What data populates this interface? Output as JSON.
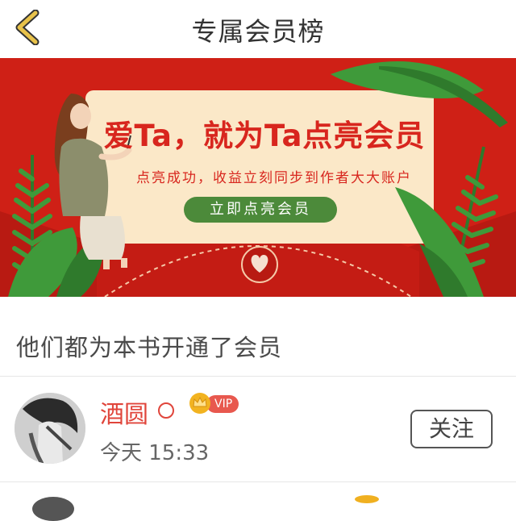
{
  "header": {
    "title": "专属会员榜"
  },
  "banner": {
    "headline": "爱Ta，就为Ta点亮会员",
    "subtitle": "点亮成功，收益立刻同步到作者大大账户",
    "cta_label": "立即点亮会员"
  },
  "section": {
    "title": "他们都为本书开通了会员"
  },
  "members": [
    {
      "name": "酒圆",
      "badge": "VIP",
      "time": "今天 15:33",
      "follow_label": "关注"
    }
  ],
  "colors": {
    "banner_red": "#d8261e",
    "accent_red": "#e0453b",
    "cta_green": "#4c8a3a",
    "back_arrow": "#e0b020"
  },
  "icons": {
    "back": "chevron-left-icon",
    "gender": "circle-icon",
    "vip_crown": "crown-icon"
  }
}
